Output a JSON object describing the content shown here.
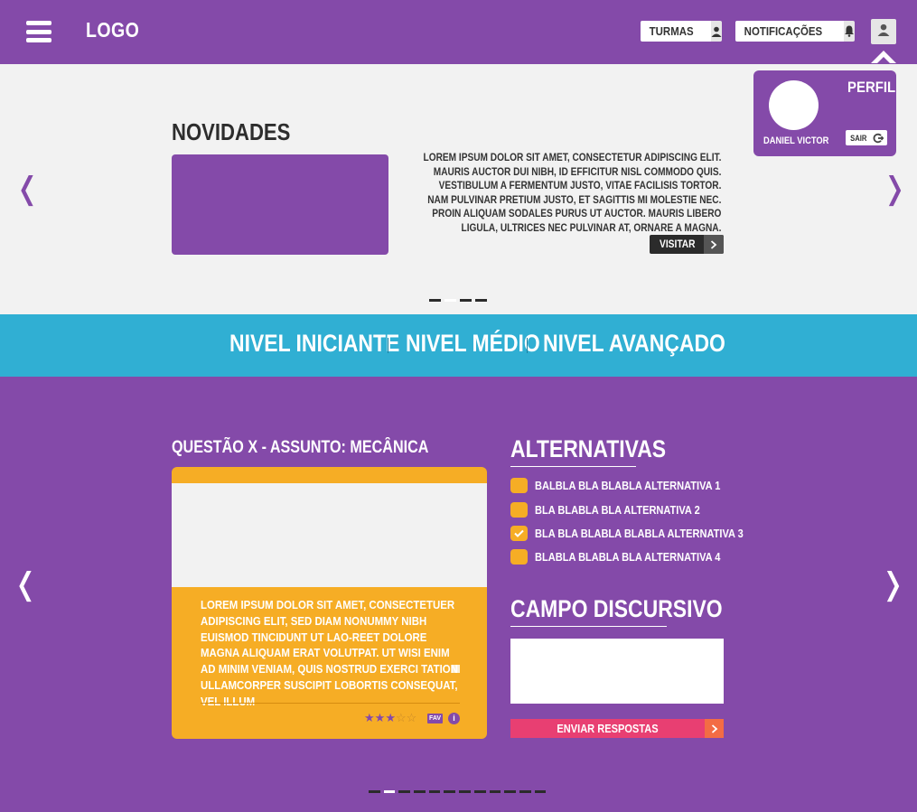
{
  "header": {
    "logo": "LOGO",
    "turmas_label": "TURMAS",
    "notificacoes_label": "NOTIFICAÇÕES",
    "brand_color": "#844aa9"
  },
  "profile": {
    "title": "PERFIL",
    "name": "DANIEL VICTOR",
    "logout_label": "SAIR"
  },
  "news": {
    "title": "NOVIDADES",
    "text": "LOREM IPSUM DOLOR SIT AMET, CONSECTETUR ADIPISCING ELIT. MAURIS AUCTOR DUI NIBH, ID EFFICITUR NISL COMMODO QUIS. VESTIBULUM A FERMENTUM JUSTO, VITAE FACILISIS TORTOR. NAM PULVINAR PRETIUM JUSTO, ET SAGITTIS MI MOLESTIE NEC. PROIN ALIQUAM SODALES PURUS UT AUCTOR. MAURIS LIBERO LIGULA, ULTRICES NEC PULVINAR AT, ORNARE A MAGNA.",
    "visit_label": "VISITAR",
    "slide_count": 4,
    "active_slide": 2
  },
  "levels": {
    "items": [
      "NIVEL INICIANTE",
      "NIVEL MÉDIO",
      "NIVEL AVANÇADO"
    ],
    "bar_color": "#30afd3"
  },
  "question": {
    "title": "QUESTÃO X - ASSUNTO: MECÂNICA",
    "text": "LOREM IPSUM DOLOR SIT AMET, CONSECTETUER ADIPISCING ELIT, SED DIAM NONUMMY NIBH EUISMOD TINCIDUNT UT LAO-REET DOLORE MAGNA ALIQUAM ERAT VOLUTPAT. UT WISI ENIM AD MINIM VENIAM, QUIS NOSTRUD EXERCI TATION ULLAMCORPER SUSCIPIT LOBORTIS CONSEQUAT, VEL ILLUM",
    "rating": 3,
    "rating_max": 5,
    "fav_label": "FAV",
    "info_label": "i",
    "card_color": "#f6ad25",
    "slide_count": 12,
    "active_slide": 2
  },
  "alternatives": {
    "title": "ALTERNATIVAS",
    "items": [
      {
        "label": "BALBLA BLA BLABLA ALTERNATIVA 1",
        "checked": false
      },
      {
        "label": "BLA BLABLA BLA ALTERNATIVA 2",
        "checked": false
      },
      {
        "label": "BLA BLA BLABLA BLABLA ALTERNATIVA 3",
        "checked": true
      },
      {
        "label": "BLABLA BLABLA BLA  ALTERNATIVA 4",
        "checked": false
      }
    ]
  },
  "discursive": {
    "title": "CAMPO DISCURSIVO",
    "value": "",
    "submit_label": "ENVIAR RESPOSTAS"
  }
}
